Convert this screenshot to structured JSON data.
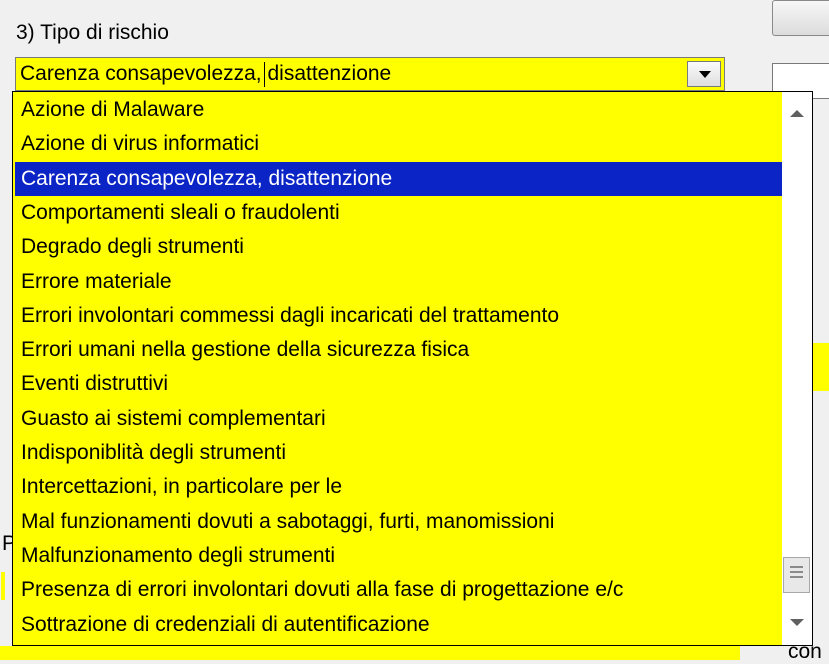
{
  "field": {
    "label": "3) Tipo di rischio",
    "value": "Carenza consapevolezza, disattenzione"
  },
  "dropdown": {
    "items": [
      "Azione di Malaware",
      "Azione di virus informatici",
      "Carenza consapevolezza, disattenzione",
      "Comportamenti sleali o fraudolenti",
      "Degrado degli strumenti",
      "Errore materiale",
      "Errori involontari commessi dagli incaricati del trattamento",
      "Errori umani nella gestione della sicurezza fisica",
      "Eventi distruttivi",
      "Guasto ai sistemi complementari",
      "Indisponiblità degli strumenti",
      "Intercettazioni, in particolare per le",
      "Mal funzionamenti dovuti a sabotaggi, furti, manomissioni",
      "Malfunzionamento degli strumenti",
      "Presenza di errori involontari dovuti alla fase di progettazione e/c",
      "Sottrazione di credenziali di autentificazione"
    ],
    "selected_index": 2
  },
  "background": {
    "left_fragment": "P",
    "bottom_right_fragment": "con"
  },
  "colors": {
    "field_background": "#ffff00",
    "selection": "#0a24c6"
  },
  "icons": {
    "combo_arrow": "chevron-down-icon",
    "scroll_up": "scroll-up-icon",
    "scroll_down": "scroll-down-icon"
  }
}
